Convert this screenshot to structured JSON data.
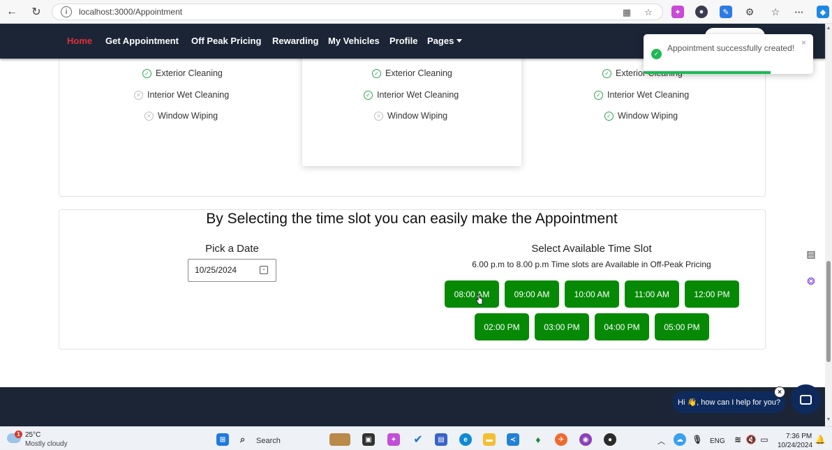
{
  "browser": {
    "url": "localhost:3000/Appointment",
    "back": "←",
    "reload": "↻",
    "more": "···"
  },
  "navbar": {
    "items": [
      {
        "label": "Home",
        "active": true
      },
      {
        "label": "Get Appointment"
      },
      {
        "label": "Off Peak Pricing"
      },
      {
        "label": "Rewarding"
      },
      {
        "label": "My Vehicles"
      },
      {
        "label": "Profile"
      },
      {
        "label": "Pages"
      }
    ]
  },
  "packages": [
    {
      "features": [
        {
          "label": "Exterior Cleaning",
          "included": true
        },
        {
          "label": "Interior Wet Cleaning",
          "included": false
        },
        {
          "label": "Window Wiping",
          "included": false
        }
      ]
    },
    {
      "features": [
        {
          "label": "Exterior Cleaning",
          "included": true
        },
        {
          "label": "Interior Wet Cleaning",
          "included": true
        },
        {
          "label": "Window Wiping",
          "included": false
        }
      ]
    },
    {
      "features": [
        {
          "label": "Exterior Cleaning",
          "included": true
        },
        {
          "label": "Interior Wet Cleaning",
          "included": true
        },
        {
          "label": "Window Wiping",
          "included": true
        }
      ]
    }
  ],
  "booking": {
    "title": "By Selecting the time slot you can easily make the Appointment",
    "date_label": "Pick a Date",
    "date_value": "10/25/2024",
    "slot_label": "Select Available Time Slot",
    "slot_note": "6.00 p.m to 8.00 p.m Time slots are Available in Off-Peak Pricing",
    "slots_row1": [
      "08:00 AM",
      "09:00 AM",
      "10:00 AM",
      "11:00 AM",
      "12:00 PM"
    ],
    "slots_row2": [
      "02:00 PM",
      "03:00 PM",
      "04:00 PM",
      "05:00 PM"
    ],
    "slot_color": "#068a06"
  },
  "toast": {
    "message": "Appointment successfully created!",
    "close": "×",
    "progress": 0.75
  },
  "chat": {
    "prompt": "Hi 👋, how can I help for you?",
    "close": "×"
  },
  "taskbar": {
    "weather_temp": "25°C",
    "weather_desc": "Mostly cloudy",
    "weather_badge": "1",
    "search_label": "Search",
    "language": "ENG",
    "time": "7:36 PM",
    "date": "10/24/2024"
  },
  "colors": {
    "navbar_bg": "#1b2536",
    "nav_active": "#e0303a",
    "check": "#2aa44f",
    "toast_green": "#1db954"
  }
}
